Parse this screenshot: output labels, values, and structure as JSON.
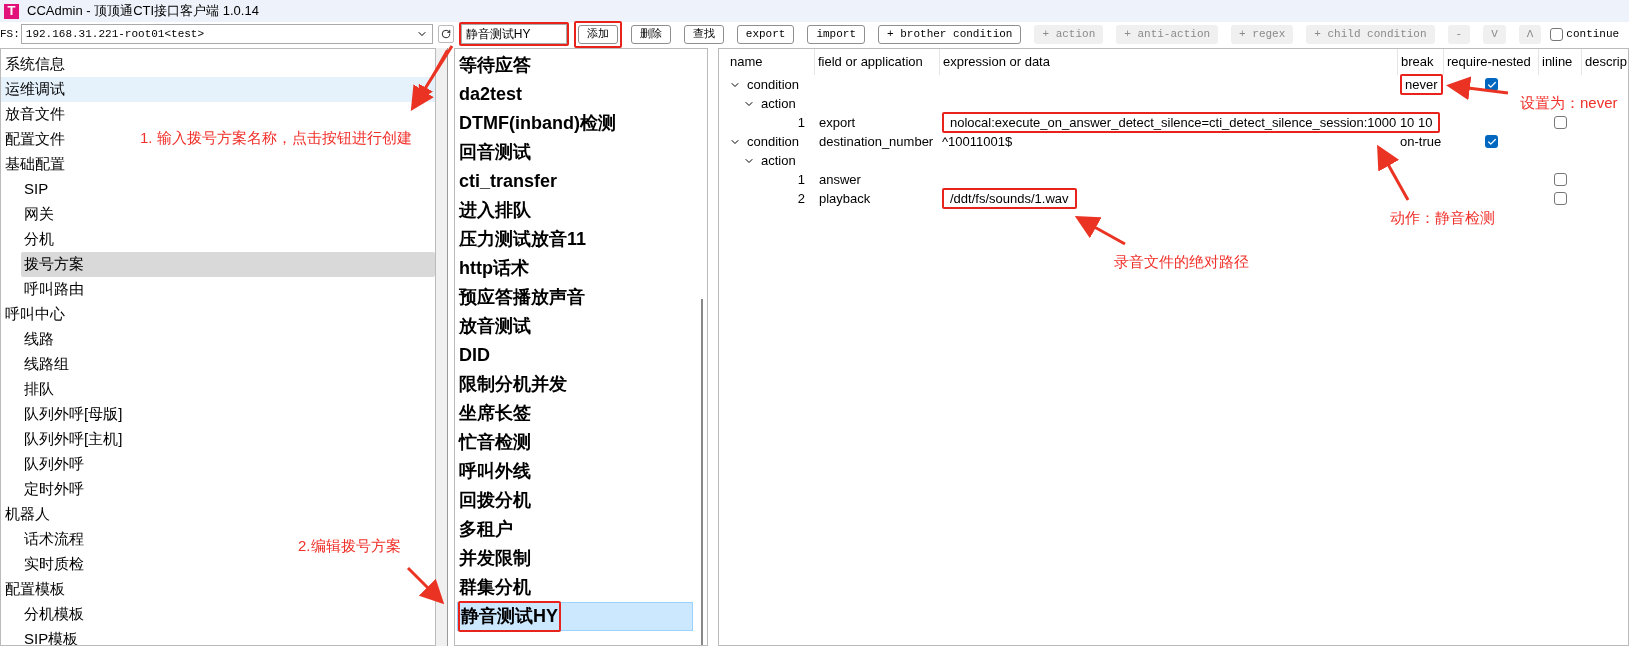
{
  "window": {
    "icon_letter": "T",
    "title": "CCAdmin - 顶顶通CTI接口客户端 1.0.14"
  },
  "toolbar": [
    {
      "kind": "label",
      "text": "FS:"
    },
    {
      "kind": "select",
      "value": "192.168.31.221-root01<test>"
    },
    {
      "kind": "refresh"
    },
    {
      "kind": "field",
      "value": "静音测试HY",
      "boxed": true
    },
    {
      "kind": "button",
      "label": "添加",
      "disabled": false,
      "boxed": true
    },
    {
      "kind": "button",
      "label": "删除",
      "disabled": false,
      "boxed": false
    },
    {
      "kind": "button",
      "label": "查找",
      "disabled": false,
      "boxed": false
    },
    {
      "kind": "button",
      "label": "export",
      "disabled": false,
      "boxed": false
    },
    {
      "kind": "button",
      "label": "import",
      "disabled": false,
      "boxed": false
    },
    {
      "kind": "button",
      "label": "+ brother condition",
      "disabled": false,
      "boxed": false
    },
    {
      "kind": "button",
      "label": "+ action",
      "disabled": true,
      "boxed": false
    },
    {
      "kind": "button",
      "label": "+ anti-action",
      "disabled": true,
      "boxed": false
    },
    {
      "kind": "button",
      "label": "+ regex",
      "disabled": true,
      "boxed": false
    },
    {
      "kind": "button",
      "label": "+ child condition",
      "disabled": true,
      "boxed": false
    },
    {
      "kind": "button",
      "label": "-",
      "disabled": true,
      "boxed": false
    },
    {
      "kind": "button",
      "label": "V",
      "disabled": true,
      "boxed": false
    },
    {
      "kind": "button",
      "label": "Λ",
      "disabled": true,
      "boxed": false
    },
    {
      "kind": "checkbox",
      "label": "continue",
      "checked": false
    }
  ],
  "nav_tree": [
    {
      "label": "系统信息",
      "hovered": false,
      "selected": false
    },
    {
      "label": "运维调试",
      "hovered": true,
      "selected": false
    },
    {
      "label": "放音文件",
      "hovered": false,
      "selected": false
    },
    {
      "label": "配置文件",
      "hovered": false,
      "selected": false
    },
    {
      "label": "基础配置",
      "hovered": false,
      "selected": false,
      "children": [
        {
          "label": "SIP",
          "hovered": false,
          "selected": false
        },
        {
          "label": "网关",
          "hovered": false,
          "selected": false
        },
        {
          "label": "分机",
          "hovered": false,
          "selected": false
        },
        {
          "label": "拨号方案",
          "hovered": false,
          "selected": true
        },
        {
          "label": "呼叫路由",
          "hovered": false,
          "selected": false
        }
      ]
    },
    {
      "label": "呼叫中心",
      "hovered": false,
      "selected": false,
      "children": [
        {
          "label": "线路",
          "hovered": false,
          "selected": false
        },
        {
          "label": "线路组",
          "hovered": false,
          "selected": false
        },
        {
          "label": "排队",
          "hovered": false,
          "selected": false
        },
        {
          "label": "队列外呼[母版]",
          "hovered": false,
          "selected": false
        },
        {
          "label": "队列外呼[主机]",
          "hovered": false,
          "selected": false
        },
        {
          "label": "队列外呼",
          "hovered": false,
          "selected": false
        },
        {
          "label": "定时外呼",
          "hovered": false,
          "selected": false
        }
      ]
    },
    {
      "label": "机器人",
      "hovered": false,
      "selected": false,
      "children": [
        {
          "label": "话术流程",
          "hovered": false,
          "selected": false
        },
        {
          "label": "实时质检",
          "hovered": false,
          "selected": false
        }
      ]
    },
    {
      "label": "配置模板",
      "hovered": false,
      "selected": false,
      "children": [
        {
          "label": "分机模板",
          "hovered": false,
          "selected": false
        },
        {
          "label": "SIP模板",
          "hovered": false,
          "selected": false
        }
      ]
    }
  ],
  "dialplan_list": [
    {
      "label": "等待应答",
      "selected": false,
      "boxed": false
    },
    {
      "label": "da2test",
      "selected": false,
      "boxed": false
    },
    {
      "label": "DTMF(inband)检测",
      "selected": false,
      "boxed": false
    },
    {
      "label": "回音测试",
      "selected": false,
      "boxed": false
    },
    {
      "label": "cti_transfer",
      "selected": false,
      "boxed": false
    },
    {
      "label": "进入排队",
      "selected": false,
      "boxed": false
    },
    {
      "label": "压力测试放音11",
      "selected": false,
      "boxed": false
    },
    {
      "label": "http话术",
      "selected": false,
      "boxed": false
    },
    {
      "label": "预应答播放声音",
      "selected": false,
      "boxed": false
    },
    {
      "label": "放音测试",
      "selected": false,
      "boxed": false
    },
    {
      "label": "DID",
      "selected": false,
      "boxed": false
    },
    {
      "label": "限制分机并发",
      "selected": false,
      "boxed": false
    },
    {
      "label": "坐席长签",
      "selected": false,
      "boxed": false
    },
    {
      "label": "忙音检测",
      "selected": false,
      "boxed": false
    },
    {
      "label": "呼叫外线",
      "selected": false,
      "boxed": false
    },
    {
      "label": "回拨分机",
      "selected": false,
      "boxed": false
    },
    {
      "label": "多租户",
      "selected": false,
      "boxed": false
    },
    {
      "label": "并发限制",
      "selected": false,
      "boxed": false
    },
    {
      "label": "群集分机",
      "selected": false,
      "boxed": false
    },
    {
      "label": "静音测试HY",
      "selected": true,
      "boxed": true
    }
  ],
  "table": {
    "columns": [
      "name",
      "field or application",
      "expression or data",
      "break",
      "require-nested",
      "inline",
      "descrip"
    ],
    "rows": [
      {
        "kind": "condition",
        "name": "condition",
        "expanded": true,
        "break": "never",
        "break_boxed": true,
        "require_nested": true,
        "children": [
          {
            "kind": "action",
            "name": "action",
            "expanded": true,
            "children": [
              {
                "kind": "step",
                "index": "1",
                "application": "export",
                "data": "nolocal:execute_on_answer_detect_silence=cti_detect_silence_session:1000 10 10",
                "data_boxed": true,
                "inline": false
              }
            ]
          }
        ]
      },
      {
        "kind": "condition",
        "name": "condition",
        "expanded": true,
        "field": "destination_number",
        "expression": "^10011001$",
        "break": "on-true",
        "break_boxed": false,
        "require_nested": true,
        "children": [
          {
            "kind": "action",
            "name": "action",
            "expanded": true,
            "children": [
              {
                "kind": "step",
                "index": "1",
                "application": "answer",
                "inline": false
              },
              {
                "kind": "step",
                "index": "2",
                "application": "playback",
                "data": "/ddt/fs/sounds/1.wav",
                "data_boxed": true,
                "inline": false
              }
            ]
          }
        ]
      }
    ]
  },
  "notes": [
    "1. 输入拨号方案名称，点击按钮进行创建",
    "2.编辑拨号方案",
    "设置为：never",
    "动作：静音检测",
    "录音文件的绝对路径"
  ]
}
